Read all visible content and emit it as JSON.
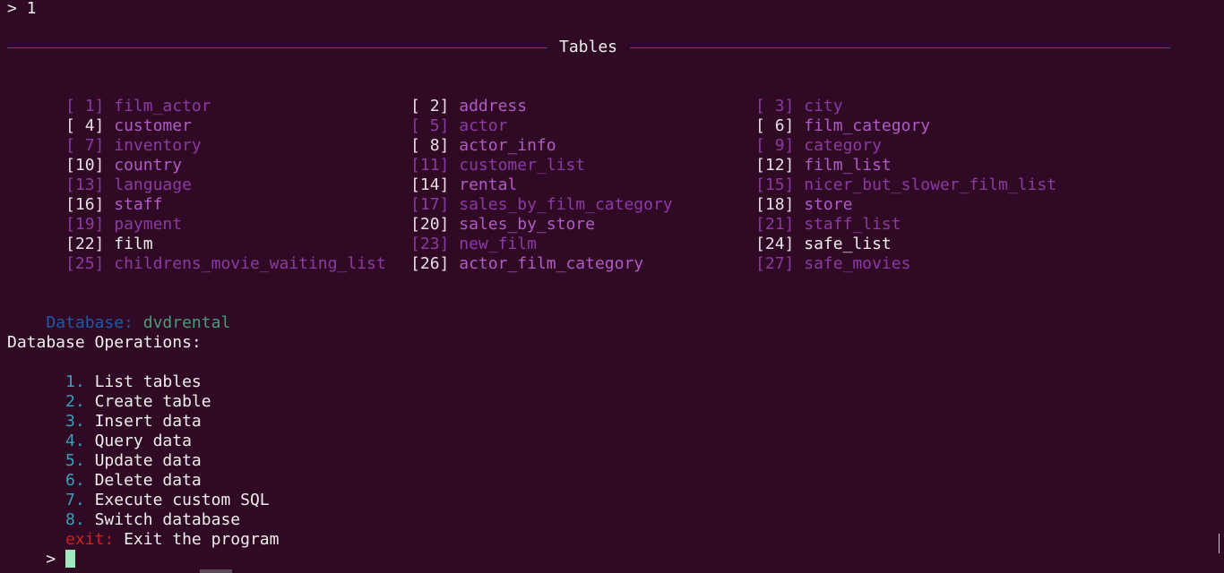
{
  "terminal": {
    "first_prompt": "> 1",
    "tables_title": "Tables",
    "tables": [
      {
        "idx": "[ 1]",
        "name": "film_actor"
      },
      {
        "idx": "[ 2]",
        "name": "address"
      },
      {
        "idx": "[ 3]",
        "name": "city"
      },
      {
        "idx": "[ 4]",
        "name": "customer"
      },
      {
        "idx": "[ 5]",
        "name": "actor"
      },
      {
        "idx": "[ 6]",
        "name": "film_category"
      },
      {
        "idx": "[ 7]",
        "name": "inventory"
      },
      {
        "idx": "[ 8]",
        "name": "actor_info"
      },
      {
        "idx": "[ 9]",
        "name": "category"
      },
      {
        "idx": "[10]",
        "name": "country"
      },
      {
        "idx": "[11]",
        "name": "customer_list"
      },
      {
        "idx": "[12]",
        "name": "film_list"
      },
      {
        "idx": "[13]",
        "name": "language"
      },
      {
        "idx": "[14]",
        "name": "rental"
      },
      {
        "idx": "[15]",
        "name": "nicer_but_slower_film_list"
      },
      {
        "idx": "[16]",
        "name": "staff"
      },
      {
        "idx": "[17]",
        "name": "sales_by_film_category"
      },
      {
        "idx": "[18]",
        "name": "store"
      },
      {
        "idx": "[19]",
        "name": "payment"
      },
      {
        "idx": "[20]",
        "name": "sales_by_store"
      },
      {
        "idx": "[21]",
        "name": "staff_list"
      },
      {
        "idx": "[22]",
        "name": "film"
      },
      {
        "idx": "[23]",
        "name": "new_film"
      },
      {
        "idx": "[24]",
        "name": "safe_list"
      },
      {
        "idx": "[25]",
        "name": "childrens_movie_waiting_list"
      },
      {
        "idx": "[26]",
        "name": "actor_film_category"
      },
      {
        "idx": "[27]",
        "name": "safe_movies"
      }
    ],
    "database_label": "Database:",
    "database_name": "dvdrental",
    "operations_header": "Database Operations:",
    "operations": [
      {
        "num": "1.",
        "label": "List tables"
      },
      {
        "num": "2.",
        "label": "Create table"
      },
      {
        "num": "3.",
        "label": "Insert data"
      },
      {
        "num": "4.",
        "label": "Query data"
      },
      {
        "num": "5.",
        "label": "Update data"
      },
      {
        "num": "6.",
        "label": "Delete data"
      },
      {
        "num": "7.",
        "label": "Execute custom SQL"
      },
      {
        "num": "8.",
        "label": "Switch database"
      }
    ],
    "exit_key": "exit:",
    "exit_label": "Exit the program",
    "input_prompt": ">"
  },
  "colors": {
    "background": "#300a24",
    "rule": "#1f5aa6",
    "table_dim": "#8b3aa3",
    "table_name": "#b05bc7",
    "op_number": "#3aa0b8",
    "db_name": "#4e9a7a",
    "exit_key": "#cc2222",
    "cursor": "#9fe8c0"
  }
}
